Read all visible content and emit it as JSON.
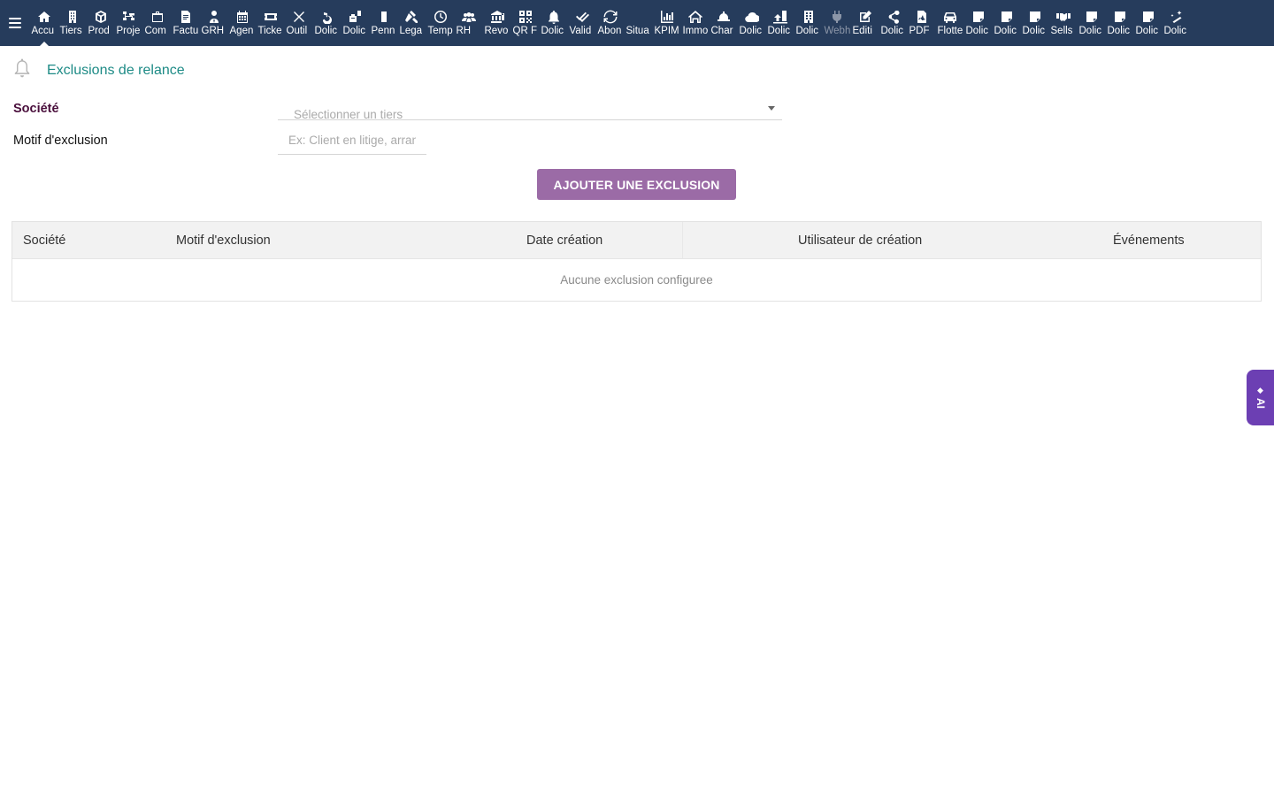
{
  "menu": [
    {
      "label": "Accu",
      "icon": "home-icon"
    },
    {
      "label": "Tiers",
      "icon": "building-icon"
    },
    {
      "label": "Prod",
      "icon": "cube-icon"
    },
    {
      "label": "Proje",
      "icon": "sitemap-icon"
    },
    {
      "label": "Com",
      "icon": "briefcase-icon"
    },
    {
      "label": "Factu",
      "icon": "invoice-icon"
    },
    {
      "label": "GRH",
      "icon": "user-tie-icon"
    },
    {
      "label": "Agen",
      "icon": "calendar-icon"
    },
    {
      "label": "Ticke",
      "icon": "ticket-icon"
    },
    {
      "label": "Outil",
      "icon": "tools-icon"
    },
    {
      "label": "Dolic",
      "icon": "undo-icon"
    },
    {
      "label": "Dolic",
      "icon": "toolbox-icon"
    },
    {
      "label": "Penn",
      "icon": "document-icon"
    },
    {
      "label": "Lega",
      "icon": "gavel-icon"
    },
    {
      "label": "Temp",
      "icon": "clock-icon"
    },
    {
      "label": "RH",
      "icon": "users-icon"
    },
    {
      "label": "Revo",
      "icon": "bank-icon"
    },
    {
      "label": "QR F",
      "icon": "qrcode-icon"
    },
    {
      "label": "Dolic",
      "icon": "bell-icon"
    },
    {
      "label": "Valid",
      "icon": "double-check-icon"
    },
    {
      "label": "Abon",
      "icon": "sync-icon"
    },
    {
      "label": "Situa",
      "icon": "blank-icon"
    },
    {
      "label": "KPIM",
      "icon": "bar-chart-icon"
    },
    {
      "label": "Immo",
      "icon": "house-icon"
    },
    {
      "label": "Char",
      "icon": "hard-hat-icon"
    },
    {
      "label": "Dolic",
      "icon": "cloud-icon"
    },
    {
      "label": "Dolic",
      "icon": "upload-icon"
    },
    {
      "label": "Dolic",
      "icon": "office-building-icon"
    },
    {
      "label": "Webh",
      "icon": "plug-icon"
    },
    {
      "label": "Editi",
      "icon": "edit-icon"
    },
    {
      "label": "Dolic",
      "icon": "share-icon"
    },
    {
      "label": "PDF",
      "icon": "pdf-icon"
    },
    {
      "label": "Flotte",
      "icon": "car-icon"
    },
    {
      "label": "Dolic",
      "icon": "note-icon"
    },
    {
      "label": "Dolic",
      "icon": "note-icon"
    },
    {
      "label": "Dolic",
      "icon": "note-icon"
    },
    {
      "label": "Sells",
      "icon": "handshake-icon"
    },
    {
      "label": "Dolic",
      "icon": "note-icon"
    },
    {
      "label": "Dolic",
      "icon": "note-icon"
    },
    {
      "label": "Dolic",
      "icon": "note-icon"
    },
    {
      "label": "Dolic",
      "icon": "magic-wand-icon"
    }
  ],
  "page": {
    "title": "Exclusions de relance",
    "icon": "bell-outline-icon"
  },
  "form": {
    "company_label": "Société",
    "company_placeholder": "Sélectionner un tiers",
    "reason_label": "Motif d'exclusion",
    "reason_placeholder": "Ex: Client en litige, arrangement...",
    "reason_value": "",
    "add_button": "AJOUTER UNE EXCLUSION"
  },
  "table": {
    "columns": [
      "Société",
      "Motif d'exclusion",
      "Date création",
      "Utilisateur de création",
      "Événements"
    ],
    "empty_text": "Aucune exclusion configuree"
  },
  "ai_tab": {
    "label": "AI",
    "icon": "sparkle-icon"
  },
  "colors": {
    "topbar": "#263c5c",
    "title": "#1e8b86",
    "company_label": "#4a0f3c",
    "button": "#9b6ba6",
    "ai_tab": "#6c3fb3"
  }
}
